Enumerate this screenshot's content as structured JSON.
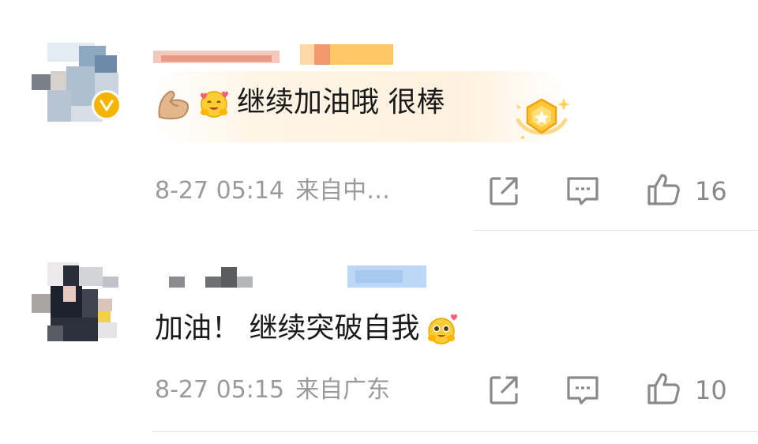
{
  "comments": [
    {
      "text": "继续加油哦 很棒",
      "emojis": [
        "flexed-biceps",
        "smiling-face-with-hearts"
      ],
      "time": "8-27 05:14",
      "source": "来自中…",
      "likes": "16",
      "verified": true,
      "has_highlight_badge": true
    },
    {
      "text": "加油！ 继续突破自我",
      "emojis": [
        "pleading-face-with-heart"
      ],
      "time": "8-27 05:15",
      "source": "来自广东",
      "likes": "10",
      "verified": false,
      "has_highlight_badge": false
    }
  ],
  "icons": {
    "repost": "share-out-icon",
    "comment": "comment-bubble-icon",
    "like": "thumbs-up-icon"
  },
  "colors": {
    "meta_gray": "#9a9a9a",
    "icon_gray": "#8a8a8a",
    "verified_gold": "#f4b400",
    "highlight_bg": "#fff1dd",
    "divider": "#e6e6e6"
  }
}
